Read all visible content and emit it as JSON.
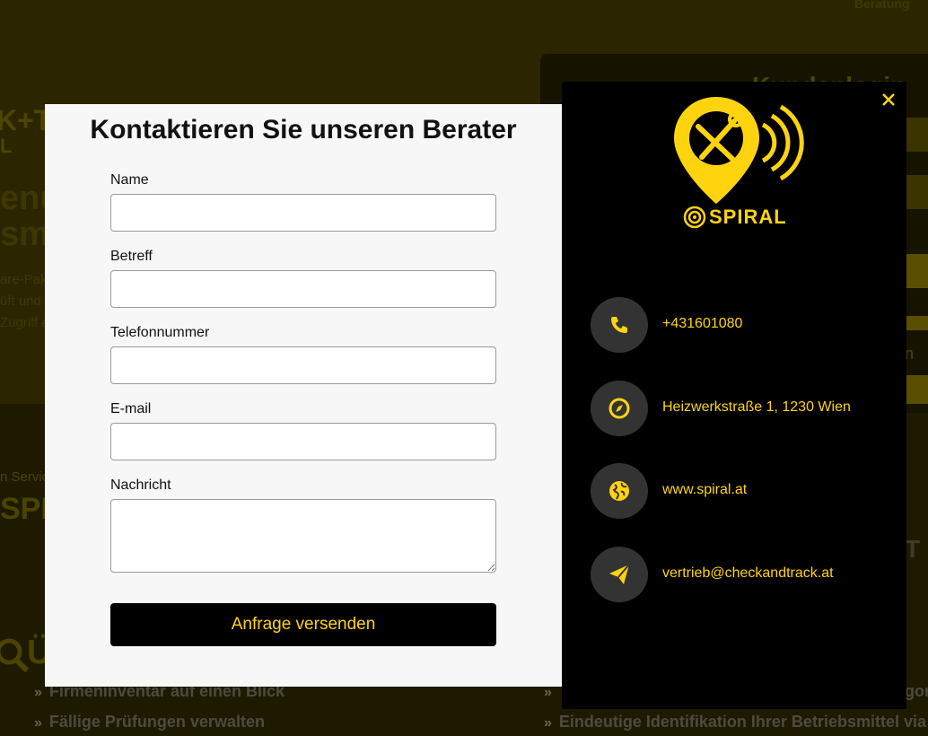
{
  "background": {
    "nav_link": "Beratung",
    "login_heading": "Kundenlogin",
    "login_link": "n",
    "hero_brand_line1": "K+T",
    "hero_brand_line2": "L",
    "hero_heading_line1": "enu",
    "hero_heading_line2": "sm",
    "hero_text": [
      "are-Pak",
      "üft und",
      "Zugriff a"
    ],
    "service_label": "n Servic",
    "spiral_text": "SPI",
    "right_fragment": "T",
    "section_heading": "Ü",
    "left_list": [
      "Firmeninventar auf einen Blick",
      "Fällige Prüfungen verwalten"
    ],
    "right_list": [
      "",
      "Eindeutige Identifikation Ihrer Betriebsmittel via SPIR"
    ],
    "right_list_fragment": "gor"
  },
  "form": {
    "title": "Kontaktieren Sie unseren Berater",
    "fields": [
      {
        "label": "Name",
        "value": ""
      },
      {
        "label": "Betreff",
        "value": ""
      },
      {
        "label": "Telefonnummer",
        "value": ""
      },
      {
        "label": "E-mail",
        "value": ""
      },
      {
        "label": "Nachricht",
        "value": ""
      }
    ],
    "submit_label": "Anfrage versenden"
  },
  "info": {
    "logo_text": "SPIRAL",
    "close_icon": "close-icon",
    "accent_color": "#ffd40f",
    "items": [
      {
        "icon": "phone-icon",
        "text": "+431601080"
      },
      {
        "icon": "compass-icon",
        "text": "Heizwerkstraße 1, 1230 Wien"
      },
      {
        "icon": "globe-icon",
        "text": "www.spiral.at"
      },
      {
        "icon": "send-icon",
        "text": "vertrieb@checkandtrack.at"
      }
    ]
  }
}
